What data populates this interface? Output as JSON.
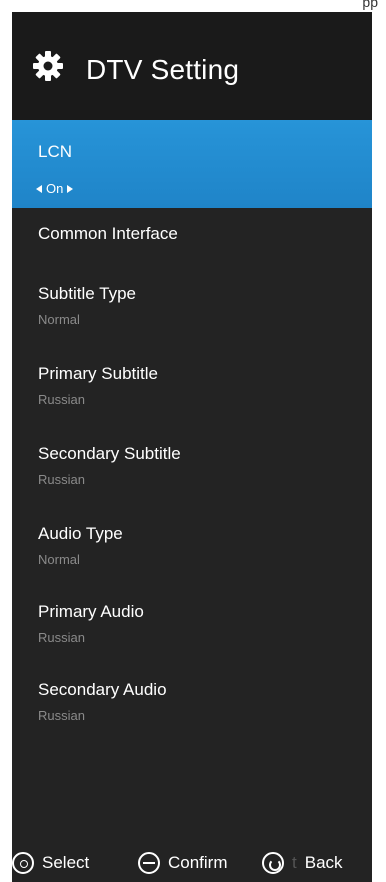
{
  "top_fragment": "pp",
  "header": {
    "title": "DTV Setting",
    "icon": "gear-icon"
  },
  "menu": {
    "items": [
      {
        "label": "LCN",
        "value": "On",
        "selected": true
      },
      {
        "label": "Common Interface",
        "value": ""
      },
      {
        "label": "Subtitle Type",
        "value": "Normal"
      },
      {
        "label": "Primary Subtitle",
        "value": "Russian"
      },
      {
        "label": "Secondary Subtitle",
        "value": "Russian"
      },
      {
        "label": "Audio Type",
        "value": "Normal"
      },
      {
        "label": "Primary Audio",
        "value": "Russian"
      },
      {
        "label": "Secondary Audio",
        "value": "Russian"
      }
    ]
  },
  "footer": {
    "select": "Select",
    "confirm": "Confirm",
    "back_separator": "t",
    "back": "Back"
  },
  "colors": {
    "panel_bg": "#232323",
    "header_bg": "#1a1a1a",
    "selected_bg": "#2794d8",
    "value_text": "#8a8a8a"
  }
}
